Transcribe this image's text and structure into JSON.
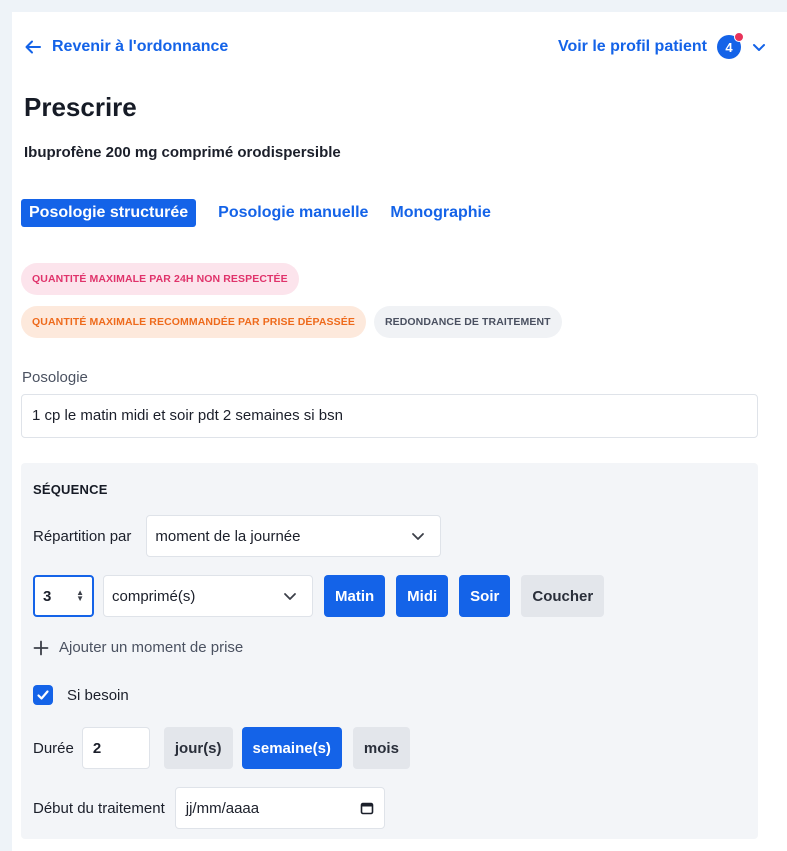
{
  "header": {
    "back_label": "Revenir à l'ordonnance",
    "profile_label": "Voir le profil patient",
    "notification_count": "4"
  },
  "page": {
    "title": "Prescrire",
    "subtitle": "Ibuprofène 200 mg comprimé orodispersible"
  },
  "tabs": [
    {
      "label": "Posologie structurée",
      "active": true
    },
    {
      "label": "Posologie manuelle",
      "active": false
    },
    {
      "label": "Monographie",
      "active": false
    }
  ],
  "alerts": [
    {
      "label": "QUANTITÉ MAXIMALE PAR 24H NON RESPECTÉE",
      "color": "#e0336b"
    },
    {
      "label": "QUANTITÉ MAXIMALE RECOMMANDÉE PAR PRISE DÉPASSÉE",
      "color": "#ee6a1c"
    },
    {
      "label": "REDONDANCE DE TRAITEMENT",
      "color": "#4a5060"
    }
  ],
  "posologie": {
    "label": "Posologie",
    "value": "1 cp le matin midi et soir pdt 2 semaines si bsn"
  },
  "sequence": {
    "title": "SÉQUENCE",
    "repartition_label": "Répartition par",
    "repartition_value": "moment de la journée",
    "quantity": "3",
    "unit": "comprimé(s)",
    "moments": [
      {
        "label": "Matin",
        "selected": true
      },
      {
        "label": "Midi",
        "selected": true
      },
      {
        "label": "Soir",
        "selected": true
      },
      {
        "label": "Coucher",
        "selected": false
      }
    ],
    "add_moment_label": "Ajouter un moment de prise",
    "si_besoin_label": "Si besoin",
    "si_besoin_checked": true,
    "duree_label": "Durée",
    "duree_value": "2",
    "duree_units": [
      {
        "label": "jour(s)",
        "selected": false
      },
      {
        "label": "semaine(s)",
        "selected": true
      },
      {
        "label": "mois",
        "selected": false
      }
    ],
    "debut_label": "Début du traitement",
    "debut_placeholder": "jj/mm/aaaa"
  },
  "colors": {
    "accent": "#1463e8",
    "notification": "#e8335a"
  }
}
